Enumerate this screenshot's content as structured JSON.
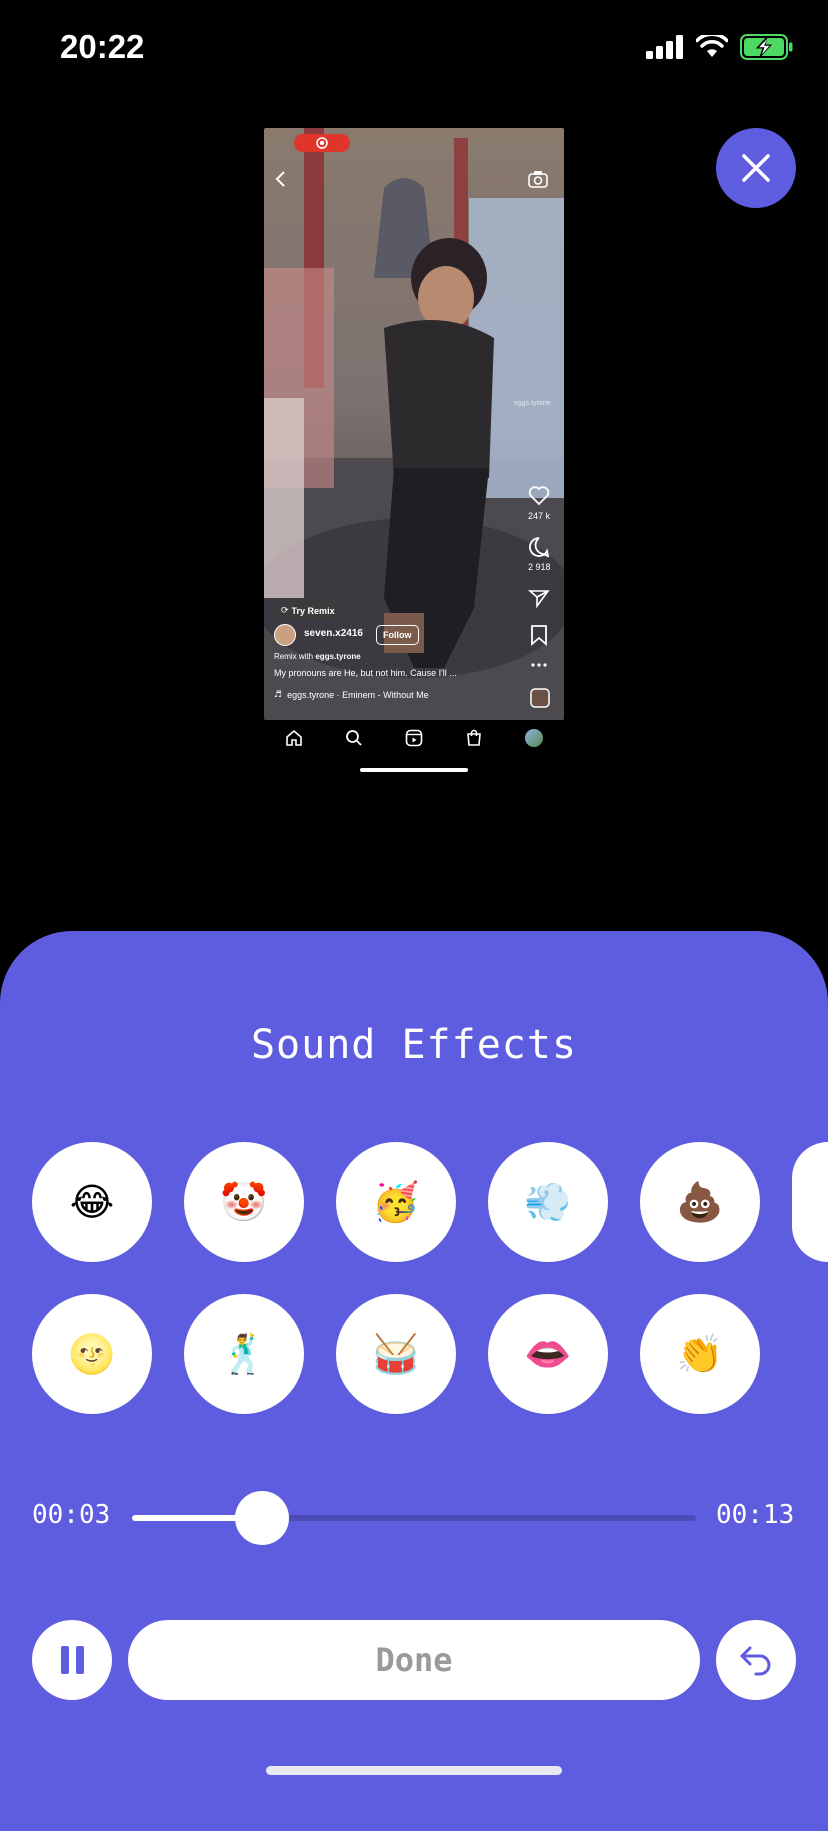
{
  "status_bar": {
    "time": "20:22"
  },
  "video": {
    "try_remix": "Try Remix",
    "username": "seven.x2416",
    "follow": "Follow",
    "remix_with_prefix": "Remix with",
    "remix_with_user": "eggs.tyrone",
    "caption": "My pronouns are He, but not him. Cause I'll ...",
    "music": "eggs.tyrone · Eminem - Without Me",
    "watermark": "eggs.tyrone",
    "likes": "247 k",
    "comments": "2 918"
  },
  "sheet": {
    "title": "Sound Effects",
    "effects": [
      {
        "emoji": "😂",
        "name": "laughing"
      },
      {
        "emoji": "🤡",
        "name": "clown"
      },
      {
        "emoji": "🥳",
        "name": "party"
      },
      {
        "emoji": "💨",
        "name": "dash"
      },
      {
        "emoji": "💩",
        "name": "poop"
      },
      {
        "emoji": "",
        "name": "partial"
      },
      {
        "emoji": "🌝",
        "name": "full-moon-face"
      },
      {
        "emoji": "🕺",
        "name": "dancer"
      },
      {
        "emoji": "🥁",
        "name": "drum"
      },
      {
        "emoji": "👄",
        "name": "lips"
      },
      {
        "emoji": "👏",
        "name": "clapping"
      }
    ],
    "time_current": "00:03",
    "time_total": "00:13",
    "progress": 0.23,
    "done_label": "Done"
  },
  "colors": {
    "accent": "#5f5ddf",
    "track": "#4d4bb8"
  }
}
